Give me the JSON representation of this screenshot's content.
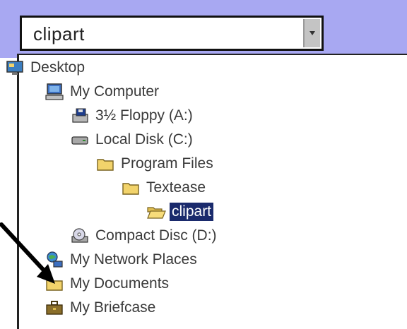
{
  "combo": {
    "value": "clipart",
    "icon": "chevron-down-icon"
  },
  "tree": {
    "items": [
      {
        "label": "Desktop",
        "icon": "desktop-icon"
      },
      {
        "label": "My Computer",
        "icon": "computer-icon"
      },
      {
        "label": "3½ Floppy (A:)",
        "icon": "floppy-drive-icon"
      },
      {
        "label": "Local Disk (C:)",
        "icon": "hard-drive-icon"
      },
      {
        "label": "Program Files",
        "icon": "folder-icon"
      },
      {
        "label": "Textease",
        "icon": "folder-icon"
      },
      {
        "label": "clipart",
        "icon": "open-folder-icon",
        "selected": true
      },
      {
        "label": "Compact Disc (D:)",
        "icon": "cd-drive-icon"
      },
      {
        "label": "My Network Places",
        "icon": "network-icon"
      },
      {
        "label": "My Documents",
        "icon": "folder-icon"
      },
      {
        "label": "My Briefcase",
        "icon": "briefcase-icon"
      }
    ]
  },
  "colors": {
    "band": "#a8a8f2",
    "selection": "#1a2a6c",
    "folder": "#f2d36b"
  }
}
